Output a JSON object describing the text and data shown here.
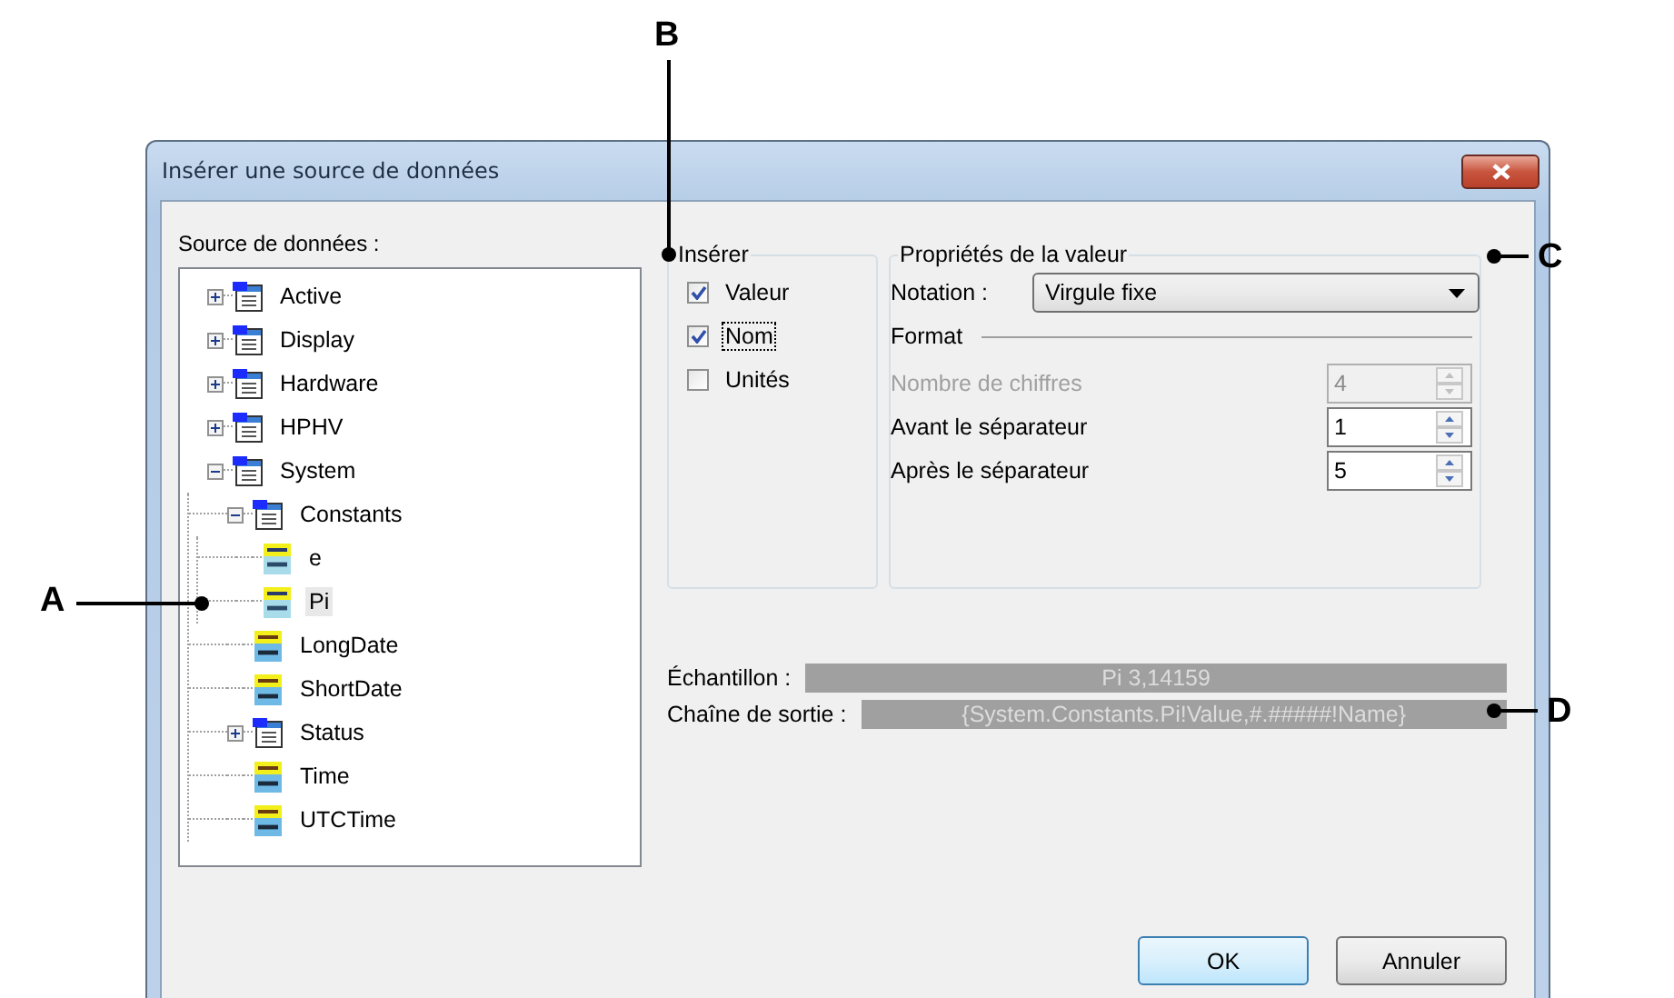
{
  "window": {
    "title": "Insérer une source de données"
  },
  "callouts": [
    {
      "label": "A"
    },
    {
      "label": "B"
    },
    {
      "label": "C"
    },
    {
      "label": "D"
    }
  ],
  "data_source": {
    "label": "Source de données :",
    "tree": [
      {
        "label": "Active",
        "kind": "group",
        "expanded": false,
        "selected": false
      },
      {
        "label": "Display",
        "kind": "group",
        "expanded": false,
        "selected": false
      },
      {
        "label": "Hardware",
        "kind": "group",
        "expanded": false,
        "selected": false
      },
      {
        "label": "HPHV",
        "kind": "group",
        "expanded": false,
        "selected": false
      },
      {
        "label": "System",
        "kind": "group",
        "expanded": true,
        "selected": false,
        "children": [
          {
            "label": "Constants",
            "kind": "group",
            "expanded": true,
            "selected": false,
            "children": [
              {
                "label": "e",
                "kind": "num",
                "selected": false
              },
              {
                "label": "Pi",
                "kind": "num",
                "selected": true
              }
            ]
          },
          {
            "label": "LongDate",
            "kind": "str",
            "selected": false
          },
          {
            "label": "ShortDate",
            "kind": "str",
            "selected": false
          },
          {
            "label": "Status",
            "kind": "group",
            "expanded": false,
            "selected": false
          },
          {
            "label": "Time",
            "kind": "str",
            "selected": false
          },
          {
            "label": "UTCTime",
            "kind": "str",
            "selected": false
          }
        ]
      }
    ]
  },
  "insert_group": {
    "title": "Insérer",
    "options": [
      {
        "label": "Valeur",
        "checked": true,
        "focused": false
      },
      {
        "label": "Nom",
        "checked": true,
        "focused": true
      },
      {
        "label": "Unités",
        "checked": false,
        "focused": false
      }
    ]
  },
  "value_properties": {
    "title": "Propriétés de la valeur",
    "notation": {
      "label": "Notation :",
      "value": "Virgule fixe"
    },
    "format_title": "Format",
    "fields": [
      {
        "label": "Nombre de chiffres",
        "value": "4",
        "disabled": true
      },
      {
        "label": "Avant le séparateur",
        "value": "1",
        "disabled": false
      },
      {
        "label": "Après le séparateur",
        "value": "5",
        "disabled": false
      }
    ]
  },
  "sample": {
    "label": "Échantillon :",
    "value": "Pi 3,14159"
  },
  "output_string": {
    "label": "Chaîne de sortie :",
    "value": "{System.Constants.Pi!Value,#.#####!Name}"
  },
  "buttons": [
    {
      "label": "OK",
      "default": true
    },
    {
      "label": "Annuler",
      "default": false
    }
  ]
}
